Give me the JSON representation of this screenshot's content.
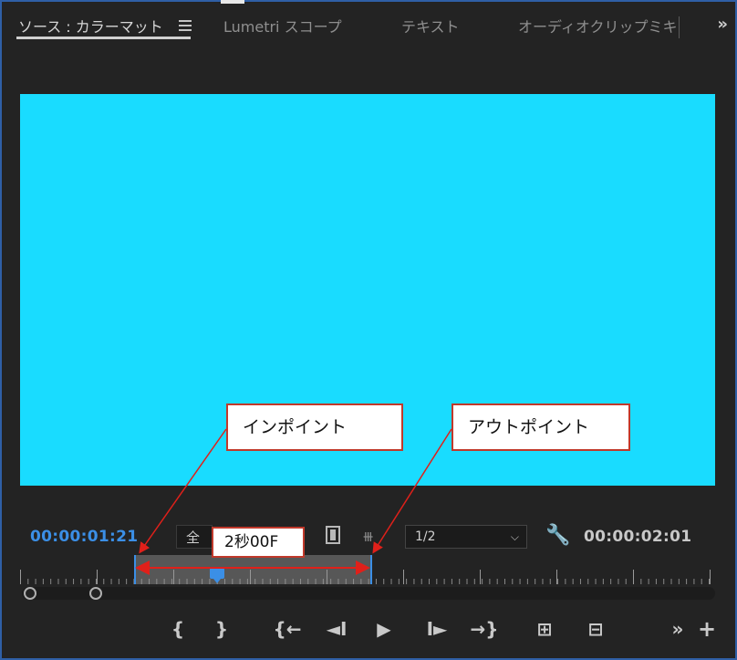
{
  "tabs": [
    {
      "label": "ソース : カラーマット",
      "active": true
    },
    {
      "label": "Lumetri スコープ",
      "active": false
    },
    {
      "label": "テキスト",
      "active": false
    },
    {
      "label": "オーディオクリップミキ",
      "active": false
    }
  ],
  "tab_overflow": "»",
  "monitor": {
    "color": "#19dcff"
  },
  "timecode": {
    "current": "00:00:01:21",
    "duration": "00:00:02:01"
  },
  "fit_select": {
    "value": "全体"
  },
  "resolution_select": {
    "value": "1/2"
  },
  "callouts": {
    "in_point": "インポイント",
    "out_point": "アウトポイント",
    "duration": "2秒00F"
  },
  "transport": {
    "mark_in": "{",
    "mark_out": "}",
    "go_to_in": "{←",
    "step_back": "◄I",
    "play": "▶",
    "step_forward": "I►",
    "go_to_out": "→}",
    "insert": "⊞",
    "overwrite": "⊟",
    "more": "»",
    "add": "+"
  },
  "colors": {
    "accent": "#3b8fe6",
    "callout_border": "#c0392b",
    "arrow": "#e0201a"
  }
}
